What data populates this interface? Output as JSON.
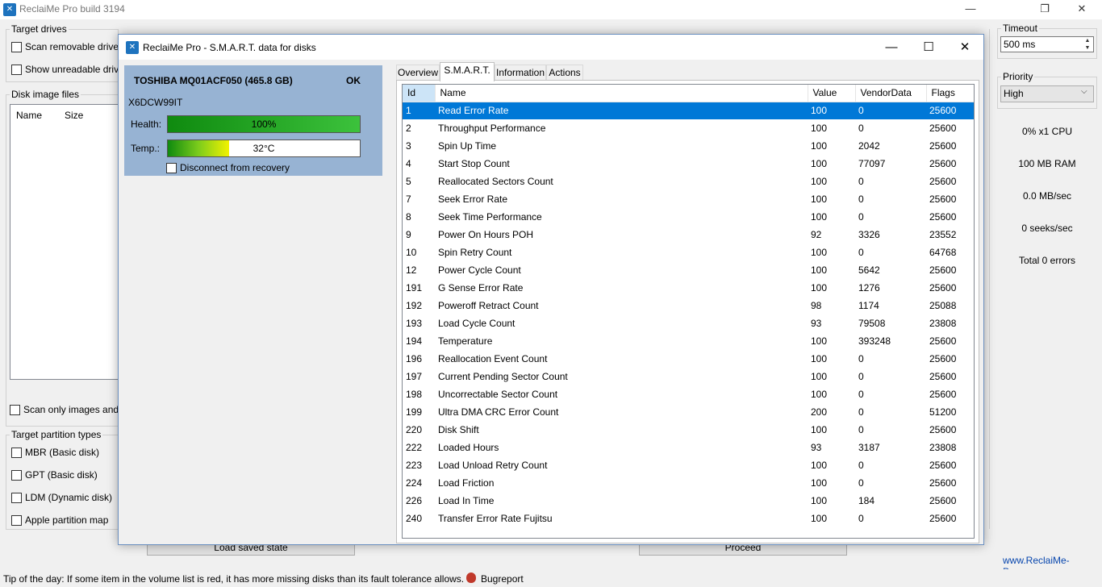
{
  "main": {
    "title": "ReclaiMe Pro build 3194",
    "target_drives": {
      "legend": "Target drives",
      "scan_removable": "Scan removable drives",
      "show_unreadable": "Show unreadable drives"
    },
    "disk_images": {
      "legend": "Disk image files",
      "col_name": "Name",
      "col_size": "Size",
      "scan_only_images": "Scan only images and R"
    },
    "partition_types": {
      "legend": "Target partition types",
      "items": [
        "MBR (Basic disk)",
        "GPT (Basic disk)",
        "LDM (Dynamic disk)",
        "Apple partition map"
      ]
    },
    "load_saved_state": "Load saved state",
    "proceed": "Proceed",
    "timeout": {
      "legend": "Timeout",
      "value": "500 ms"
    },
    "priority": {
      "legend": "Priority",
      "value": "High"
    },
    "stats": [
      "0% x1 CPU",
      "100 MB RAM",
      "0.0 MB/sec",
      "0 seeks/sec",
      "Total 0 errors"
    ],
    "site": "www.ReclaiMe-Pro.com",
    "tip": "Tip of the day: If some item in the volume list is red, it has more missing disks than its fault tolerance allows.",
    "bugreport": "Bugreport"
  },
  "dialog": {
    "title": "ReclaiMe Pro - S.M.A.R.T. data for disks",
    "disk": {
      "model": "TOSHIBA MQ01ACF050 (465.8 GB)",
      "status": "OK",
      "serial": "X6DCW99IT",
      "health_label": "Health:",
      "health_value": "100%",
      "health_fraction": 1.0,
      "temp_label": "Temp.:",
      "temp_value": "32°C",
      "temp_fraction": 0.32,
      "disconnect": "Disconnect from recovery"
    },
    "tabs": [
      "Overview",
      "S.M.A.R.T.",
      "Information",
      "Actions"
    ],
    "active_tab": 1,
    "columns": [
      "Id",
      "Name",
      "Value",
      "VendorData",
      "Flags"
    ],
    "selected_row": 0,
    "rows": [
      [
        "1",
        "Read Error Rate",
        "100",
        "0",
        "25600"
      ],
      [
        "2",
        "Throughput Performance",
        "100",
        "0",
        "25600"
      ],
      [
        "3",
        "Spin Up Time",
        "100",
        "2042",
        "25600"
      ],
      [
        "4",
        "Start Stop Count",
        "100",
        "77097",
        "25600"
      ],
      [
        "5",
        "Reallocated Sectors Count",
        "100",
        "0",
        "25600"
      ],
      [
        "7",
        "Seek Error Rate",
        "100",
        "0",
        "25600"
      ],
      [
        "8",
        "Seek Time Performance",
        "100",
        "0",
        "25600"
      ],
      [
        "9",
        "Power On Hours POH",
        "92",
        "3326",
        "23552"
      ],
      [
        "10",
        "Spin Retry Count",
        "100",
        "0",
        "64768"
      ],
      [
        "12",
        "Power Cycle Count",
        "100",
        "5642",
        "25600"
      ],
      [
        "191",
        "G Sense Error Rate",
        "100",
        "1276",
        "25600"
      ],
      [
        "192",
        "Poweroff Retract Count",
        "98",
        "1174",
        "25088"
      ],
      [
        "193",
        "Load Cycle Count",
        "93",
        "79508",
        "23808"
      ],
      [
        "194",
        "Temperature",
        "100",
        "393248",
        "25600"
      ],
      [
        "196",
        "Reallocation Event Count",
        "100",
        "0",
        "25600"
      ],
      [
        "197",
        "Current Pending Sector Count",
        "100",
        "0",
        "25600"
      ],
      [
        "198",
        "Uncorrectable Sector Count",
        "100",
        "0",
        "25600"
      ],
      [
        "199",
        "Ultra  DMA CRC Error Count",
        "200",
        "0",
        "51200"
      ],
      [
        "220",
        "Disk Shift",
        "100",
        "0",
        "25600"
      ],
      [
        "222",
        "Loaded Hours",
        "93",
        "3187",
        "23808"
      ],
      [
        "223",
        "Load Unload Retry Count",
        "100",
        "0",
        "25600"
      ],
      [
        "224",
        "Load Friction",
        "100",
        "0",
        "25600"
      ],
      [
        "226",
        "Load In Time",
        "100",
        "184",
        "25600"
      ],
      [
        "240",
        "Transfer Error Rate Fujitsu",
        "100",
        "0",
        "25600"
      ]
    ]
  }
}
